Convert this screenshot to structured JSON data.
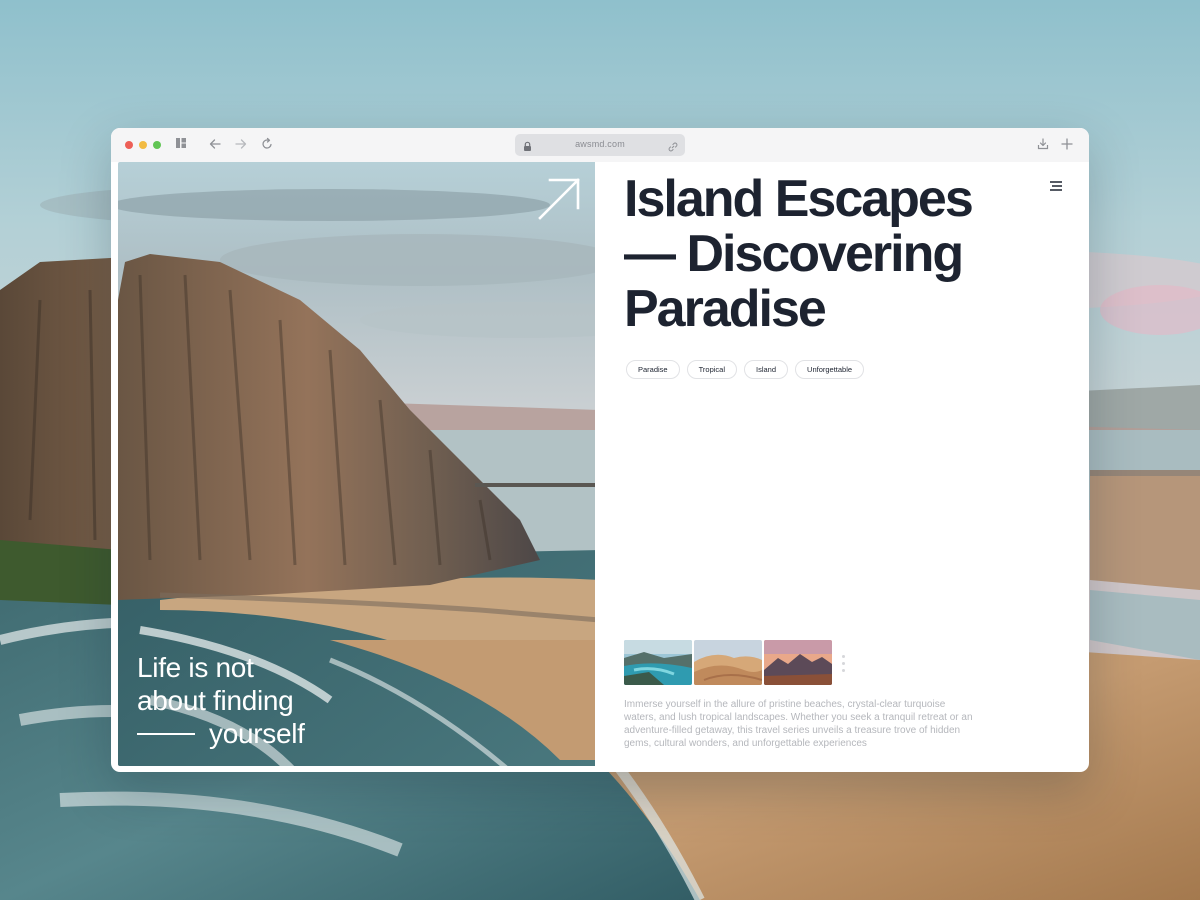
{
  "browser": {
    "url": "awsmd.com",
    "icons": [
      "sidebar-icon",
      "back-arrow-icon",
      "forward-arrow-icon",
      "reload-icon",
      "lock-icon",
      "link-icon",
      "download-icon",
      "new-tab-plus-icon"
    ]
  },
  "hero": {
    "quote_lines": [
      "Life is not",
      "about finding",
      "yourself"
    ],
    "arrow_icon": "arrow-up-right-icon"
  },
  "article": {
    "title_lines": [
      "Island Escapes",
      "— Discovering",
      "Paradise"
    ],
    "tags": [
      "Paradise",
      "Tropical",
      "Island",
      "Unforgettable"
    ],
    "description": "Immerse yourself in the allure of pristine beaches, crystal-clear turquoise waters, and lush tropical landscapes. Whether you seek a tranquil retreat or an adventure-filled getaway, this travel series unveils a treasure trove of hidden gems, cultural wonders, and unforgettable experiences",
    "gallery": [
      "lagoon",
      "desert dunes",
      "mountain sunset"
    ],
    "menu_icon": "hamburger-menu-icon"
  },
  "colors": {
    "text_dark": "#1d2330",
    "text_muted": "#b5b7bc",
    "chrome_bg": "#f5f5f6",
    "close_dot": "#ed5f57",
    "minimize_dot": "#f2bb43",
    "zoom_dot": "#61c554"
  }
}
